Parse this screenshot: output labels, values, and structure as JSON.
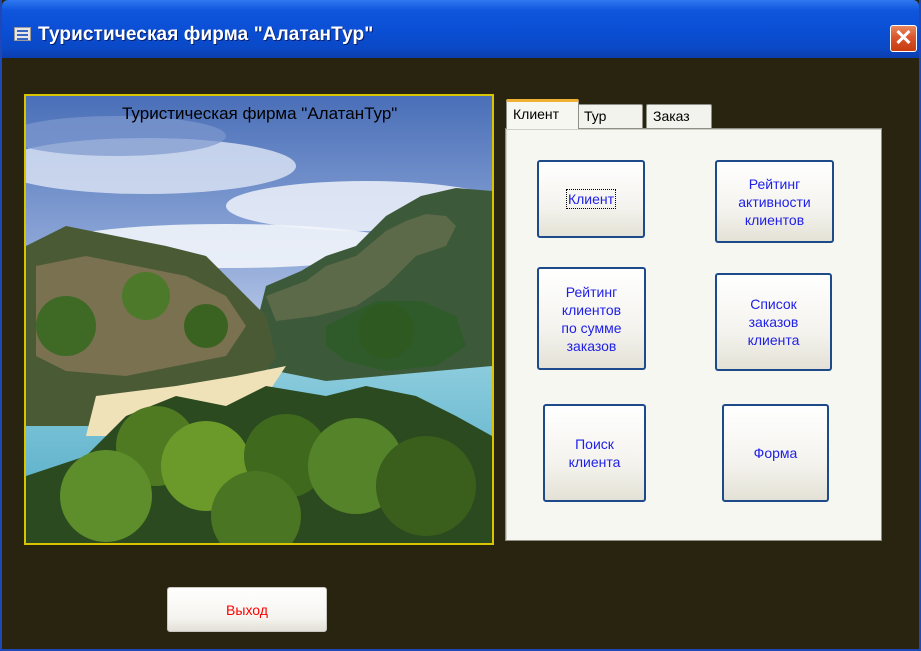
{
  "window": {
    "title": "Туристическая фирма \"АлатанТур\"",
    "close_symbol": "✕",
    "icon": "form-icon"
  },
  "picture": {
    "caption": "Туристическая фирма \"АлатанТур\"",
    "description_icon": "tropical-island-image"
  },
  "tabs": [
    {
      "label": "Клиент",
      "active": true
    },
    {
      "label": "Тур",
      "active": false
    },
    {
      "label": "Заказ",
      "active": false
    }
  ],
  "client_tab": {
    "buttons": [
      {
        "label_lines": [
          "Клиент"
        ]
      },
      {
        "label_lines": [
          "Рейтинг",
          "активности",
          "клиентов"
        ]
      },
      {
        "label_lines": [
          "Рейтинг",
          "клиентов",
          "по сумме",
          "заказов"
        ]
      },
      {
        "label_lines": [
          "Список",
          "заказов",
          "клиента"
        ]
      },
      {
        "label_lines": [
          "Поиск",
          "клиента"
        ]
      },
      {
        "label_lines": [
          "Форма"
        ]
      }
    ]
  },
  "footer": {
    "exit_label": "Выход"
  },
  "colors": {
    "titlebar": "#0a4ed4",
    "form_background": "#292410",
    "button_text": "#2020e8",
    "exit_text": "#ff0000",
    "picture_border": "#d8c400",
    "active_tab_accent": "#f2b033"
  }
}
